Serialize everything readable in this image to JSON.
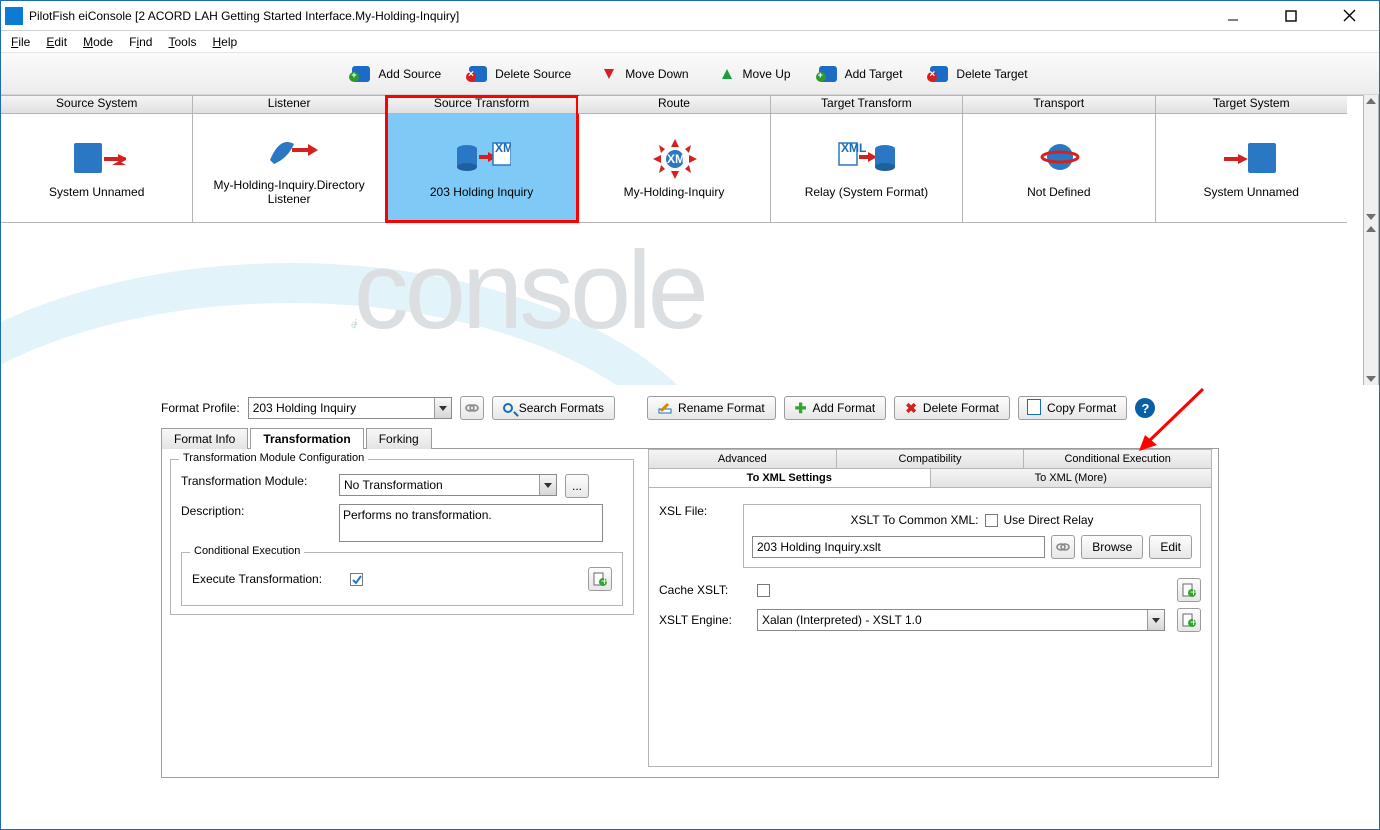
{
  "window": {
    "title": "PilotFish eiConsole [2 ACORD LAH Getting Started Interface.My-Holding-Inquiry]"
  },
  "menu": {
    "file": "File",
    "edit": "Edit",
    "mode": "Mode",
    "find": "Find",
    "tools": "Tools",
    "help": "Help"
  },
  "toolbar": {
    "addSource": "Add Source",
    "deleteSource": "Delete Source",
    "moveDown": "Move Down",
    "moveUp": "Move Up",
    "addTarget": "Add Target",
    "deleteTarget": "Delete Target"
  },
  "stages": {
    "headers": [
      "Source System",
      "Listener",
      "Source Transform",
      "Route",
      "Target Transform",
      "Transport",
      "Target System"
    ],
    "labels": [
      "System Unnamed",
      "My-Holding-Inquiry.Directory Listener",
      "203 Holding Inquiry",
      "My-Holding-Inquiry",
      "Relay (System Format)",
      "Not Defined",
      "System Unnamed"
    ]
  },
  "formatBar": {
    "label": "Format Profile:",
    "value": "203 Holding Inquiry",
    "search": "Search Formats",
    "rename": "Rename Format",
    "add": "Add Format",
    "delete": "Delete Format",
    "copy": "Copy Format"
  },
  "tabs": {
    "info": "Format Info",
    "transformation": "Transformation",
    "forking": "Forking"
  },
  "tmc": {
    "legend": "Transformation Module Configuration",
    "moduleLabel": "Transformation Module:",
    "moduleValue": "No Transformation",
    "ellipsis": "...",
    "descLabel": "Description:",
    "descValue": "Performs no transformation.",
    "condLegend": "Conditional Execution",
    "execLabel": "Execute Transformation:"
  },
  "rightTabs": {
    "advanced": "Advanced",
    "compatibility": "Compatibility",
    "conditional": "Conditional Execution",
    "toXml": "To XML Settings",
    "toXmlMore": "To XML (More)"
  },
  "xsl": {
    "fileLabel": "XSL File:",
    "commonLabel": "XSLT To Common XML:",
    "relayLabel": "Use Direct Relay",
    "fileValue": "203 Holding Inquiry.xslt",
    "browse": "Browse",
    "edit": "Edit",
    "cacheLabel": "Cache XSLT:",
    "engineLabel": "XSLT Engine:",
    "engineValue": "Xalan (Interpreted) - XSLT 1.0"
  }
}
